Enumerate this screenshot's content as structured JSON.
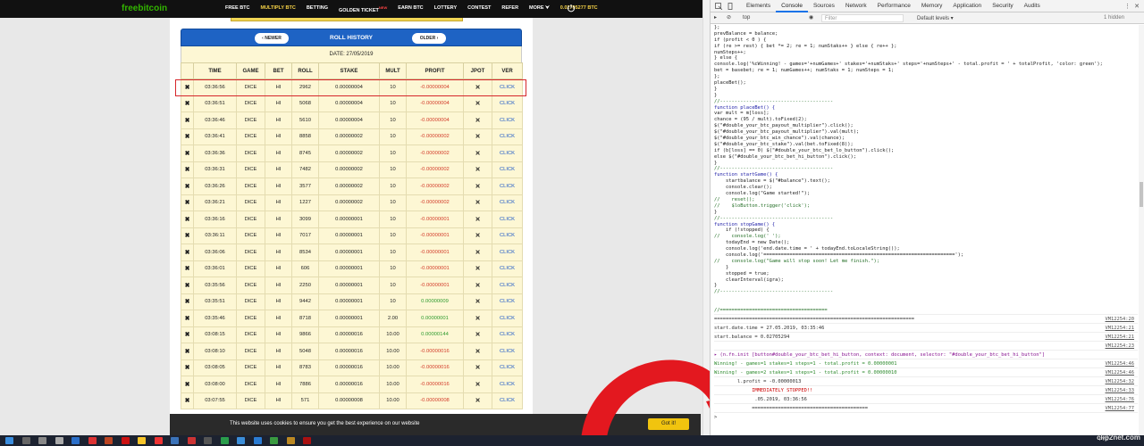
{
  "site": {
    "logo": "freebitcoin",
    "nav": [
      {
        "label": "FREE BTC",
        "active": false
      },
      {
        "label": "MULTIPLY BTC",
        "active": true
      },
      {
        "label": "BETTING",
        "active": false
      },
      {
        "label": "GOLDEN TICKET",
        "active": false,
        "badge": "NEW"
      },
      {
        "label": "EARN BTC",
        "active": false
      },
      {
        "label": "LOTTERY",
        "active": false
      },
      {
        "label": "CONTEST",
        "active": false
      },
      {
        "label": "REFER",
        "active": false
      },
      {
        "label": "MORE ⮟",
        "active": false
      }
    ],
    "balance": "0.02705277 BTC",
    "history": {
      "title": "ROLL HISTORY",
      "newer": "‹ NEWER",
      "older": "OLDER ›",
      "date": "DATE: 27/05/2019",
      "columns": [
        "",
        "TIME",
        "GAME",
        "BET",
        "ROLL",
        "STAKE",
        "MULT",
        "PROFIT",
        "JPOT",
        "VER"
      ],
      "rows": [
        [
          "03:36:56",
          "DICE",
          "HI",
          "2962",
          "0.00000004",
          "10",
          "-0.00000004",
          "neg"
        ],
        [
          "03:36:51",
          "DICE",
          "HI",
          "5068",
          "0.00000004",
          "10",
          "-0.00000004",
          "neg"
        ],
        [
          "03:36:46",
          "DICE",
          "HI",
          "5610",
          "0.00000004",
          "10",
          "-0.00000004",
          "neg"
        ],
        [
          "03:36:41",
          "DICE",
          "HI",
          "8858",
          "0.00000002",
          "10",
          "-0.00000002",
          "neg"
        ],
        [
          "03:36:36",
          "DICE",
          "HI",
          "8745",
          "0.00000002",
          "10",
          "-0.00000002",
          "neg"
        ],
        [
          "03:36:31",
          "DICE",
          "HI",
          "7482",
          "0.00000002",
          "10",
          "-0.00000002",
          "neg"
        ],
        [
          "03:36:26",
          "DICE",
          "HI",
          "3577",
          "0.00000002",
          "10",
          "-0.00000002",
          "neg"
        ],
        [
          "03:36:21",
          "DICE",
          "HI",
          "1227",
          "0.00000002",
          "10",
          "-0.00000002",
          "neg"
        ],
        [
          "03:36:16",
          "DICE",
          "HI",
          "3099",
          "0.00000001",
          "10",
          "-0.00000001",
          "neg"
        ],
        [
          "03:36:11",
          "DICE",
          "HI",
          "7017",
          "0.00000001",
          "10",
          "-0.00000001",
          "neg"
        ],
        [
          "03:36:06",
          "DICE",
          "HI",
          "8534",
          "0.00000001",
          "10",
          "-0.00000001",
          "neg"
        ],
        [
          "03:36:01",
          "DICE",
          "HI",
          "606",
          "0.00000001",
          "10",
          "-0.00000001",
          "neg"
        ],
        [
          "03:35:56",
          "DICE",
          "HI",
          "2250",
          "0.00000001",
          "10",
          "-0.00000001",
          "neg"
        ],
        [
          "03:35:51",
          "DICE",
          "HI",
          "9442",
          "0.00000001",
          "10",
          "0.00000009",
          "pos"
        ],
        [
          "03:35:46",
          "DICE",
          "HI",
          "8718",
          "0.00000001",
          "2.00",
          "0.00000001",
          "pos"
        ],
        [
          "03:08:15",
          "DICE",
          "HI",
          "9866",
          "0.00000016",
          "10.00",
          "0.00000144",
          "pos"
        ],
        [
          "03:08:10",
          "DICE",
          "HI",
          "5048",
          "0.00000016",
          "10.00",
          "-0.00000016",
          "neg"
        ],
        [
          "03:08:05",
          "DICE",
          "HI",
          "8783",
          "0.00000016",
          "10.00",
          "-0.00000016",
          "neg"
        ],
        [
          "03:08:00",
          "DICE",
          "HI",
          "7886",
          "0.00000016",
          "10.00",
          "-0.00000016",
          "neg"
        ],
        [
          "03:07:55",
          "DICE",
          "HI",
          "571",
          "0.00000008",
          "10.00",
          "-0.00000008",
          "neg"
        ]
      ],
      "jpot": "✕",
      "ver": "CLICK"
    },
    "cookie": {
      "text": "This website uses cookies to ensure you get the best experience on our website",
      "button": "Got it!"
    }
  },
  "devtools": {
    "tabs": [
      "Elements",
      "Console",
      "Sources",
      "Network",
      "Performance",
      "Memory",
      "Application",
      "Security",
      "Audits"
    ],
    "active_tab": "Console",
    "context": "top",
    "filter_placeholder": "Filter",
    "levels": "Default levels ▾",
    "hidden": "1 hidden",
    "code": [
      "};",
      "prevBalance = balance;",
      "if (profit < 0 ) {",
      "if (re >= rest) { bet *= 2; re = 1; numStaks++ } else { re++ };",
      "numSteps++;",
      "} else {",
      "console.log('%cWinning! - games='+numGames+' stakes='+numStaks+' steps='+numSteps+' - total.profit = ' + totalProfit, 'color: green');",
      "bet = basebet; re = 1; numGames++; numStaks = 1; numSteps = 1;",
      "};",
      "placeBet();",
      "}",
      "}",
      "//---------------------------------------",
      "function placeBet() {",
      "var mult = m[loss];",
      "chance = (95 / mult).toFixed(2);",
      "$(\"#double_your_btc_payout_multiplier\").click();",
      "$(\"#double_your_btc_payout_multiplier\").val(mult);",
      "$(\"#double_your_btc_win_chance\").val(chance);",
      "$(\"#double_your_btc_stake\").val(bet.toFixed(8));",
      "if (b[loss] == 0) $(\"#double_your_btc_bet_lo_button\").click();",
      "else $(\"#double_your_btc_bet_hi_button\").click();",
      "}",
      "//---------------------------------------",
      "function startGame() {",
      "    startbalance = $(\"#balance\").text();",
      "    console.clear();",
      "    console.log(\"Game started!\");",
      "//    reset();",
      "//    $loButton.trigger('click');",
      "}",
      "//---------------------------------------",
      "function stopGame() {",
      "    if (!stopped) {",
      "//    console.log(' ');",
      "    todayEnd = new Date();",
      "    console.log('end.date.time = ' + todayEnd.toLocaleString());",
      "    console.log('==================================================================');",
      "//    console.log(\"Game will stop soon! Let me finish.\");",
      "    }",
      "    stopped = true;",
      "    clearInterval(igra);",
      "}",
      "//---------------------------------------",
      "",
      "",
      "//====================================="
    ],
    "output": [
      {
        "text": "=====================================================================",
        "src": "VM12254:20",
        "cls": ""
      },
      {
        "text": "start.date.time = 27.05.2019, 03:35:46",
        "src": "VM12254:21",
        "cls": ""
      },
      {
        "text": "start.balance = 0.02705294",
        "src": "VM12254:21",
        "cls": ""
      },
      {
        "text": "",
        "src": "VM12254:23",
        "cls": ""
      },
      {
        "text": "▸ (n.fn.init [button#double_your_btc_bet_hi_button, context: document, selector: \"#double_your_btc_bet_hi_button\"]",
        "src": "",
        "cls": "obj"
      },
      {
        "text": "Winning! - games=1 stakes=1 steps=1 - total.profit = 0.00000001",
        "src": "VM12254:46",
        "cls": "green"
      },
      {
        "text": "Winning! - games=2 stakes=1 steps=1 - total.profit = 0.00000010",
        "src": "VM12254:46",
        "cls": "green"
      },
      {
        "text": "        l.profit = -0.00000013",
        "src": "VM12254:32",
        "cls": ""
      },
      {
        "text": "             IMMEDIATELY STOPPED!!",
        "src": "VM12254:33",
        "cls": "red"
      },
      {
        "text": "              .05.2019, 03:36:56",
        "src": "VM12254:76",
        "cls": ""
      },
      {
        "text": "             ========================================",
        "src": "VM12254:77",
        "cls": ""
      }
    ],
    "prompt": ">"
  },
  "taskbar": {
    "tray": "PYC",
    "watermark": "clip2net.com"
  }
}
